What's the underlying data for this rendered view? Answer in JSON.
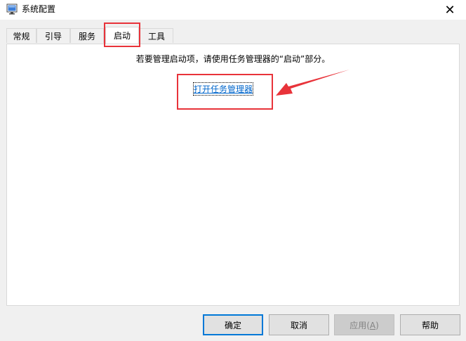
{
  "window": {
    "title": "系统配置",
    "icon": "msconfig-icon",
    "close_glyph": "✕"
  },
  "tabs": [
    {
      "label": "常规"
    },
    {
      "label": "引导"
    },
    {
      "label": "服务"
    },
    {
      "label": "启动",
      "active": true
    },
    {
      "label": "工具"
    }
  ],
  "startup": {
    "instruction": "若要管理启动项，请使用任务管理器的“启动”部分。",
    "link_text": "打开任务管理器"
  },
  "buttons": {
    "ok": "确定",
    "cancel": "取消",
    "apply_prefix": "应用(",
    "apply_key": "A",
    "apply_suffix": ")",
    "help": "帮助"
  },
  "colors": {
    "annotation": "#e8333a",
    "link": "#0066cc",
    "default_button_border": "#0078d7"
  }
}
